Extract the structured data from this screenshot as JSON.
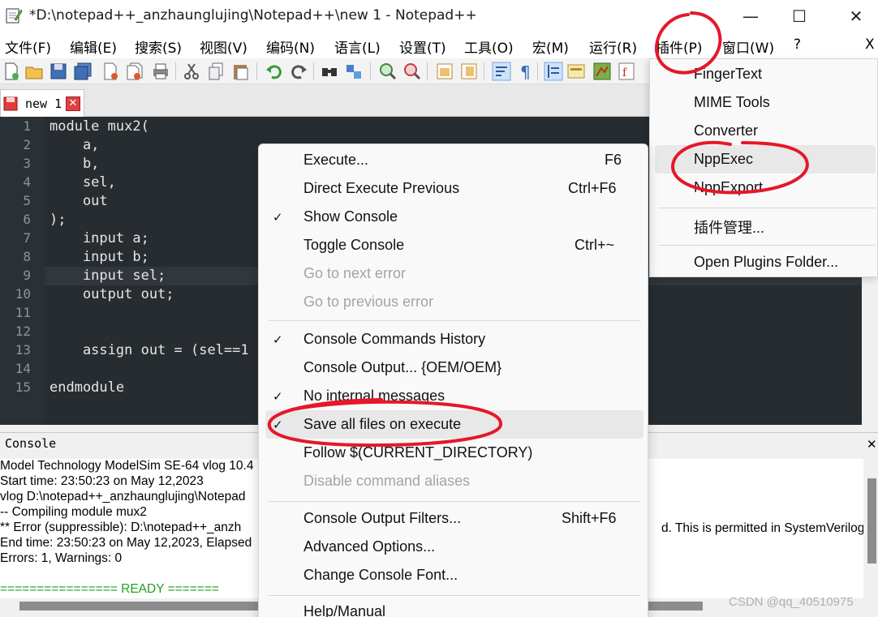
{
  "window": {
    "title": "*D:\\notepad++_anzhaunglujing\\Notepad++\\new 1 - Notepad++",
    "minimize_glyph": "—",
    "maximize_glyph": "☐",
    "close_glyph": "✕"
  },
  "menubar": {
    "items": [
      "文件(F)",
      "编辑(E)",
      "搜索(S)",
      "视图(V)",
      "编码(N)",
      "语言(L)",
      "设置(T)",
      "工具(O)",
      "宏(M)",
      "运行(R)",
      "插件(P)",
      "窗口(W)",
      "?",
      "X"
    ]
  },
  "tabs": [
    {
      "label": "new 1",
      "close_glyph": "✕"
    }
  ],
  "editor": {
    "line_numbers": [
      "1",
      "2",
      "3",
      "4",
      "5",
      "6",
      "7",
      "8",
      "9",
      "10",
      "11",
      "12",
      "13",
      "14",
      "15"
    ],
    "lines": [
      "module mux2(",
      "    a,",
      "    b,",
      "    sel,",
      "    out",
      ");",
      "    input a;",
      "    input b;",
      "    input sel;",
      "    output out;",
      "",
      "",
      "    assign out = (sel==1",
      "",
      "endmodule"
    ]
  },
  "console": {
    "title": "Console",
    "close_glyph": "✕",
    "lines": [
      "Model Technology ModelSim SE-64 vlog 10.4",
      "Start time: 23:50:23 on May 12,2023",
      "vlog D:\\notepad++_anzhaunglujing\\Notepad",
      "-- Compiling module mux2",
      "** Error (suppressible): D:\\notepad++_anzh",
      "End time: 23:50:23 on May 12,2023, Elapsed",
      "Errors: 1, Warnings: 0",
      "",
      "================ READY ======="
    ],
    "overflow_text": "d. This is permitted in SystemVerilog"
  },
  "plugins_menu": {
    "items": [
      "FingerText",
      "MIME Tools",
      "Converter",
      "NppExec",
      "NppExport",
      "插件管理...",
      "Open Plugins Folder..."
    ]
  },
  "nppexec_menu": {
    "items": [
      {
        "label": "Execute...",
        "shortcut": "F6"
      },
      {
        "label": "Direct Execute Previous",
        "shortcut": "Ctrl+F6"
      },
      {
        "label": "Show Console"
      },
      {
        "label": "Toggle Console",
        "shortcut": "Ctrl+~"
      },
      {
        "label": "Go to next error"
      },
      {
        "label": "Go to previous error"
      },
      {
        "label": "Console Commands History"
      },
      {
        "label": "Console Output... {OEM/OEM}"
      },
      {
        "label": "No internal messages"
      },
      {
        "label": "Save all files on execute"
      },
      {
        "label": "Follow $(CURRENT_DIRECTORY)"
      },
      {
        "label": "Disable command aliases"
      },
      {
        "label": "Console Output Filters...",
        "shortcut": "Shift+F6"
      },
      {
        "label": "Advanced Options..."
      },
      {
        "label": "Change Console Font..."
      },
      {
        "label": "Help/Manual"
      }
    ],
    "check_glyph": "✓"
  },
  "watermark": "CSDN @qq_40510975",
  "colors": {
    "editor_bg": "#272c30",
    "annotation_red": "#e5172a",
    "ready_green": "#22a022"
  }
}
